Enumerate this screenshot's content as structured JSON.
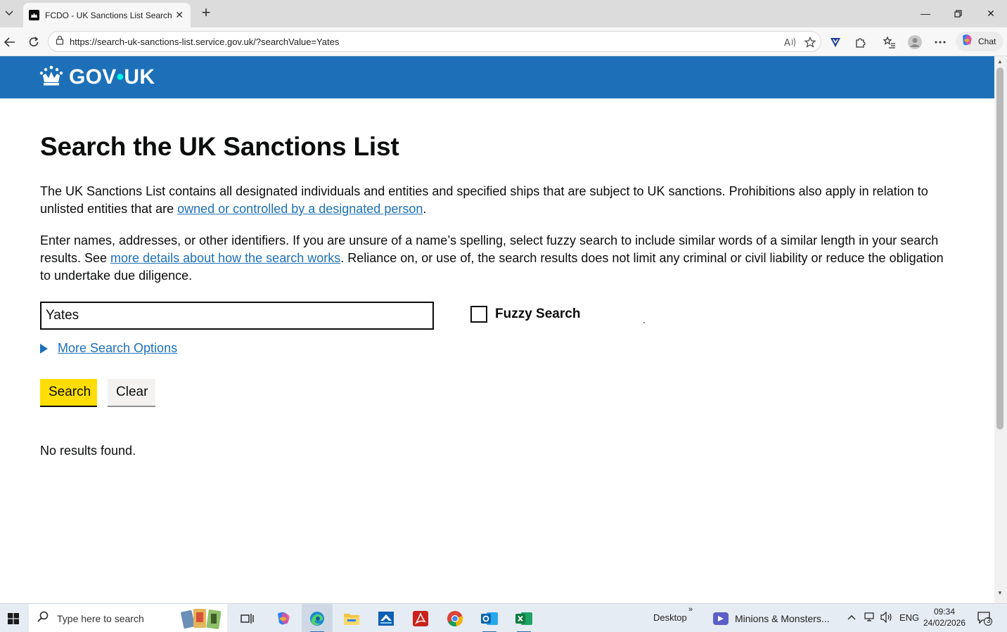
{
  "browser": {
    "tab_title": "FCDO - UK Sanctions List Search -",
    "url": "https://search-uk-sanctions-list.service.gov.uk/?searchValue=Yates",
    "chat_label": "Chat"
  },
  "header": {
    "logo_left": "GOV",
    "logo_dot": "•",
    "logo_right": "UK"
  },
  "main": {
    "title": "Search the UK Sanctions List",
    "intro_text": "The UK Sanctions List contains all designated individuals and entities and specified ships that are subject to UK sanctions. Prohibitions also apply in relation to unlisted entities that are ",
    "intro_link": "owned or controlled by a designated person",
    "intro_end": ".",
    "help_text_1": "Enter names, addresses, or other identifiers. If you are unsure of a name’s spelling, select fuzzy search to include similar words of a similar length in your search results. See ",
    "help_link": "more details about how the search works",
    "help_text_2": ". Reliance on, or use of, the search results does not limit any criminal or civil liability or reduce the obligation to undertake due diligence.",
    "search_value": "Yates",
    "fuzzy_label": "Fuzzy Search",
    "fuzzy_checked": false,
    "more_options": "More Search Options",
    "search_button": "Search",
    "clear_button": "Clear",
    "results_text": "No results found."
  },
  "taskbar": {
    "search_placeholder": "Type here to search",
    "desktop_label": "Desktop",
    "desktop_chevron": "»",
    "meeting_label": "Minions & Monsters...",
    "lang": "ENG",
    "time": "09:34",
    "date": "24/02/2026",
    "notification_count": "3"
  },
  "colors": {
    "govuk_blue": "#1d70b8",
    "link": "#1d70b8",
    "search_button": "#ffdd00",
    "text": "#0b0c0c"
  }
}
